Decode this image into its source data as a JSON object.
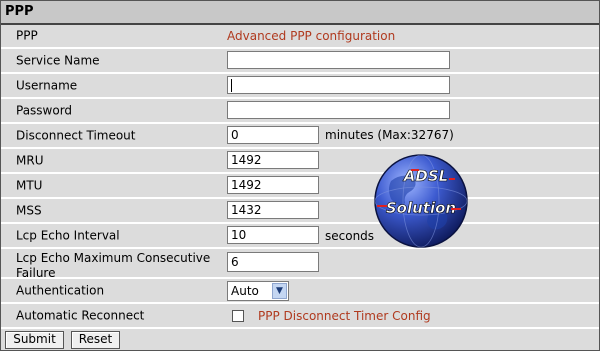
{
  "section_title": "PPP",
  "rows": {
    "ppp": {
      "label": "PPP",
      "link": "Advanced PPP configuration"
    },
    "service_name": {
      "label": "Service Name",
      "value": ""
    },
    "username": {
      "label": "Username",
      "value": ""
    },
    "password": {
      "label": "Password",
      "value": ""
    },
    "disconnect_timeout": {
      "label": "Disconnect Timeout",
      "value": "0",
      "unit": "minutes (Max:32767)"
    },
    "mru": {
      "label": "MRU",
      "value": "1492"
    },
    "mtu": {
      "label": "MTU",
      "value": "1492"
    },
    "mss": {
      "label": "MSS",
      "value": "1432"
    },
    "lcp_echo_interval": {
      "label": "Lcp Echo Interval",
      "value": "10",
      "unit": "seconds"
    },
    "lcp_echo_max_failure": {
      "label": "Lcp Echo Maximum Consecutive Failure",
      "value": "6"
    },
    "authentication": {
      "label": "Authentication",
      "selected": "Auto"
    },
    "auto_reconnect": {
      "label": "Automatic Reconnect",
      "checked": false,
      "link": "PPP Disconnect Timer Config"
    }
  },
  "buttons": {
    "submit": "Submit",
    "reset": "Reset"
  },
  "watermark": {
    "line1": "ADSL",
    "line2": "Solution"
  },
  "colors": {
    "link": "#b03a1f",
    "row_bg": "#dcdcdc",
    "header_bg": "#c8c8c8"
  }
}
